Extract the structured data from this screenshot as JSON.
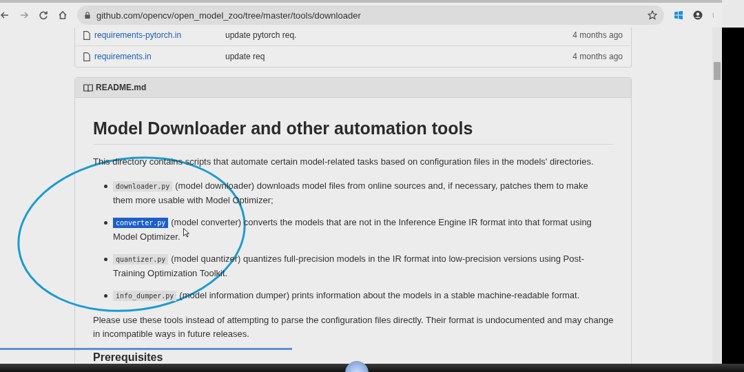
{
  "browser": {
    "url": "github.com/opencv/open_model_zoo/tree/master/tools/downloader"
  },
  "files": [
    {
      "name": "requirements-pytorch.in",
      "message": "update pytorch req.",
      "age": "4 months ago"
    },
    {
      "name": "requirements.in",
      "message": "update req",
      "age": "4 months ago"
    }
  ],
  "readme": {
    "filename": "README.md",
    "heading": "Model Downloader and other automation tools",
    "intro": "This directory contains scripts that automate certain model-related tasks based on configuration files in the models' directories.",
    "items": [
      {
        "code": "downloader.py",
        "selected": false,
        "text": "(model downloader) downloads model files from online sources and, if necessary, patches them to make them more usable with Model Optimizer;"
      },
      {
        "code": "converter.py",
        "selected": true,
        "text": "(model converter) converts the models that are not in the Inference Engine IR format into that format using Model Optimizer."
      },
      {
        "code": "quantizer.py",
        "selected": false,
        "text": "(model quantizer) quantizes full-precision models in the IR format into low-precision versions using Post-Training Optimization Toolkit."
      },
      {
        "code": "info_dumper.py",
        "selected": false,
        "text": "(model information dumper) prints information about the models in a stable machine-readable format."
      }
    ],
    "outro": "Please use these tools instead of attempting to parse the configuration files directly. Their format is undocumented and may change in incompatible ways in future releases.",
    "subheading": "Prerequisites"
  },
  "video_player": {
    "level": 0.41
  }
}
